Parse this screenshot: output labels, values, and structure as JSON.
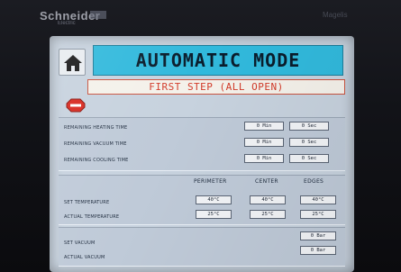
{
  "device": {
    "brand": "Schneider",
    "brand_sub": "Electric",
    "model": "Magelis"
  },
  "header": {
    "title": "AUTOMATIC MODE",
    "step": "FIRST STEP (ALL OPEN)"
  },
  "icons": {
    "home": "home-icon",
    "stop": "stop-icon"
  },
  "colors": {
    "title_bg": "#31b9dc",
    "step_text": "#d23b2a",
    "stop_red": "#d8281e",
    "screen_bg": "#c7d2de"
  },
  "remaining_times": {
    "rows": [
      {
        "label": "REMAINING HEATING TIME",
        "min": "0 Min",
        "sec": "0 Sec"
      },
      {
        "label": "REMAINING VACUUM TIME",
        "min": "0 Min",
        "sec": "0 Sec"
      },
      {
        "label": "REMAINING COOLING TIME",
        "min": "0 Min",
        "sec": "0 Sec"
      }
    ]
  },
  "temperatures": {
    "columns": [
      "PERIMETER",
      "CENTER",
      "EDGES"
    ],
    "set_label": "SET TEMPERATURE",
    "actual_label": "ACTUAL TEMPERATURE",
    "set": [
      "40°C",
      "40°C",
      "40°C"
    ],
    "actual": [
      "25°C",
      "25°C",
      "25°C"
    ]
  },
  "pressure": {
    "set_label": "SET VACUUM",
    "actual_label": "ACTUAL VACUUM",
    "set": "0 Bar",
    "actual": "0 Bar"
  }
}
